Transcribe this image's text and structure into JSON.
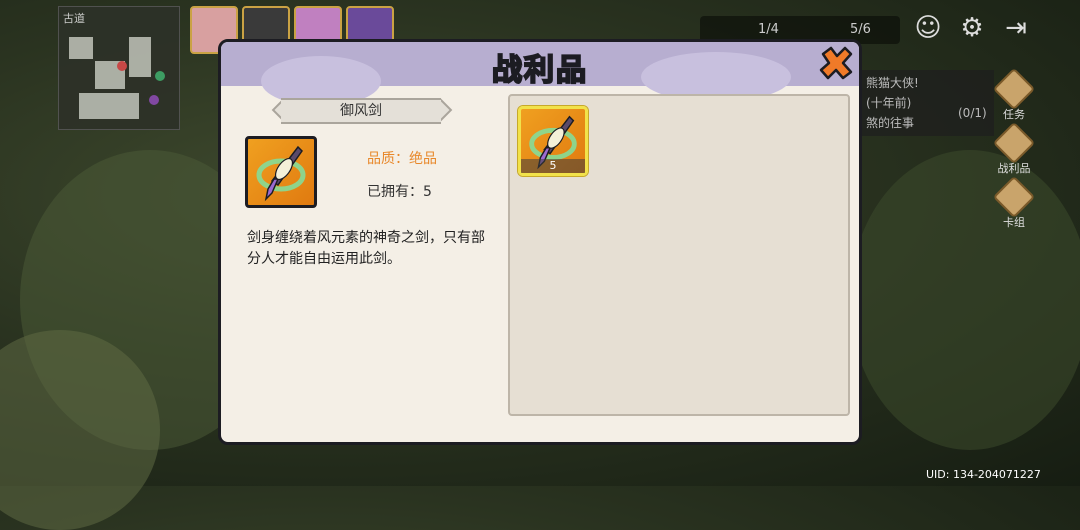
{
  "background": {
    "minimap_title": "古道",
    "topbar": {
      "left_value": "1/4",
      "right_value": "5/6"
    },
    "quest": {
      "line1": "熊猫大侠!",
      "line2": "(十年前)",
      "line3": "煞的往事",
      "count": "(0/1)"
    },
    "side_buttons": [
      {
        "label": "任务"
      },
      {
        "label": "战利品"
      },
      {
        "label": "卡组"
      }
    ],
    "uid": "UID: 134-204071227"
  },
  "modal": {
    "title": "战利品",
    "item": {
      "name": "御风剑",
      "quality": "品质：绝品",
      "owned": "已拥有：5",
      "description": "剑身缠绕着风元素的神奇之剑，只有部分人才能自由运用此剑。"
    },
    "slots": [
      {
        "count": "5",
        "icon": "wind-sword-icon"
      }
    ]
  },
  "colors": {
    "header": "#b7aed0",
    "panel": "#f4efe6",
    "quality": "#e8882a",
    "item_bg": "#f0a020",
    "close": "#f07a28"
  }
}
